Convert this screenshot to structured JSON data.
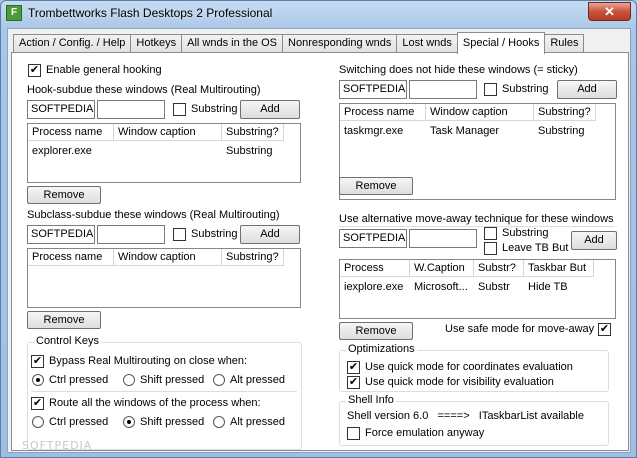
{
  "window": {
    "title": "Trombettworks Flash Desktops 2 Professional",
    "close_label": "✕",
    "icon_letter": "F"
  },
  "tabs": [
    {
      "label": "Action / Config. / Help"
    },
    {
      "label": "Hotkeys"
    },
    {
      "label": "All wnds in the OS"
    },
    {
      "label": "Nonresponding wnds"
    },
    {
      "label": "Lost wnds"
    },
    {
      "label": "Special / Hooks"
    },
    {
      "label": "Rules"
    }
  ],
  "left": {
    "enable_hooking": {
      "label": "Enable general hooking",
      "checked": true
    },
    "hook_section": {
      "label": "Hook-subdue these windows (Real Multirouting)",
      "input_value": "SOFTPEDIA",
      "input2_value": "",
      "substring_label": "Substring",
      "add_label": "Add",
      "columns": [
        "Process name",
        "Window caption",
        "Substring?"
      ],
      "rows": [
        [
          "explorer.exe",
          "",
          "Substring"
        ]
      ],
      "remove_label": "Remove"
    },
    "subclass_section": {
      "label": "Subclass-subdue these windows (Real Multirouting)",
      "input_value": "SOFTPEDIA",
      "input2_value": "",
      "substring_label": "Substring",
      "add_label": "Add",
      "columns": [
        "Process name",
        "Window caption",
        "Substring?"
      ],
      "rows": [],
      "remove_label": "Remove"
    },
    "control_keys": {
      "label": "Control Keys",
      "bypass_label": "Bypass Real Multirouting on close when:",
      "bypass_checked": true,
      "route_label": "Route all the windows of the process when:",
      "route_checked": true,
      "ctrl_label": "Ctrl pressed",
      "shift_label": "Shift pressed",
      "alt_label": "Alt pressed"
    }
  },
  "right": {
    "sticky_section": {
      "label": "Switching does not hide these windows (= sticky)",
      "input_value": "SOFTPEDIA",
      "input2_value": "",
      "substring_label": "Substring",
      "add_label": "Add",
      "columns": [
        "Process name",
        "Window caption",
        "Substring?"
      ],
      "rows": [
        [
          "taskmgr.exe",
          "Task Manager",
          "Substring"
        ]
      ],
      "remove_label": "Remove"
    },
    "moveaway_section": {
      "label": "Use alternative move-away technique for these windows",
      "input_value": "SOFTPEDIA",
      "input2_value": "",
      "substring_label": "Substring",
      "leave_tb_label": "Leave TB But",
      "add_label": "Add",
      "columns": [
        "Process",
        "W.Caption",
        "Substr?",
        "Taskbar But"
      ],
      "rows": [
        [
          "iexplore.exe",
          "Microsoft...",
          "Substr",
          "Hide TB"
        ]
      ],
      "remove_label": "Remove",
      "safe_mode_label": "Use safe mode for move-away",
      "safe_mode_checked": true
    },
    "optimizations": {
      "label": "Optimizations",
      "coords_label": "Use quick mode for coordinates evaluation",
      "visibility_label": "Use quick mode for visibility evaluation"
    },
    "shell_info": {
      "label": "Shell Info",
      "version_text": "Shell version 6.0   ====>   ITaskbarList available",
      "force_label": "Force emulation anyway"
    }
  },
  "watermark": "SOFTPEDIA"
}
